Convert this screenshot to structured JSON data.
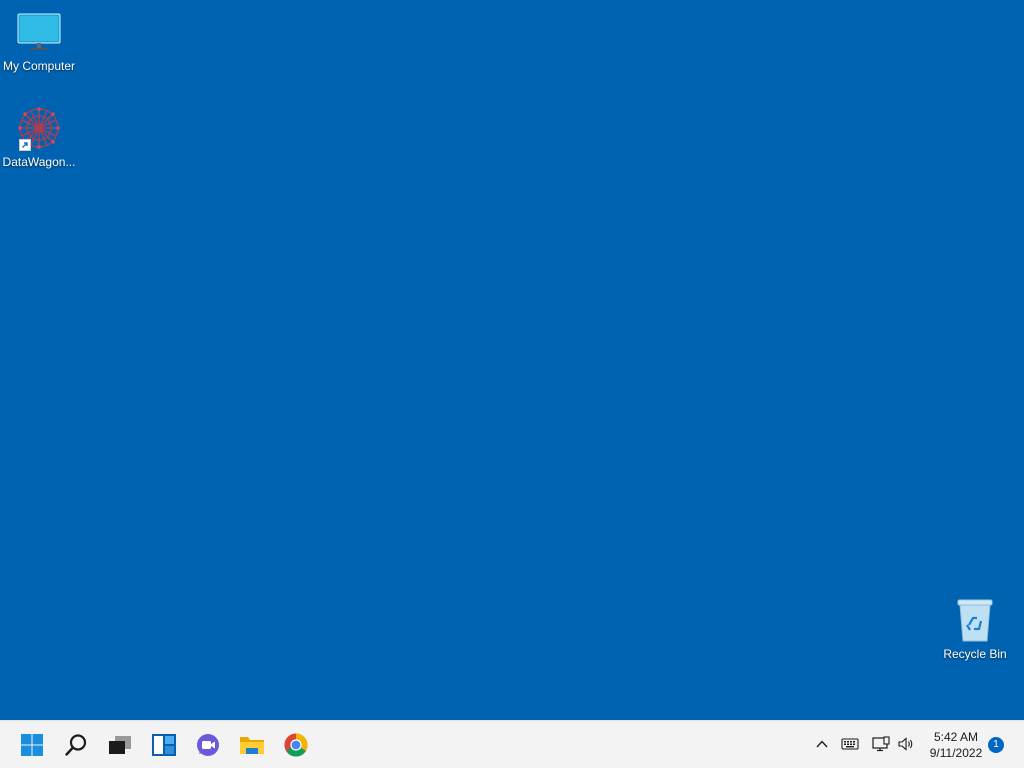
{
  "desktop": {
    "background_color": "#0063b1",
    "icons": [
      {
        "label": "My Computer",
        "icon": "monitor-icon"
      },
      {
        "label": "DataWagon...",
        "icon": "datawagon-app-icon"
      },
      {
        "label": "Recycle Bin",
        "icon": "recycle-bin-icon"
      }
    ]
  },
  "taskbar": {
    "pinned": [
      {
        "name": "Start",
        "icon": "windows-start-icon"
      },
      {
        "name": "Search",
        "icon": "search-icon"
      },
      {
        "name": "Task View",
        "icon": "task-view-icon"
      },
      {
        "name": "Widgets",
        "icon": "widgets-icon"
      },
      {
        "name": "Chat",
        "icon": "chat-icon"
      },
      {
        "name": "File Explorer",
        "icon": "folder-icon"
      },
      {
        "name": "Google Chrome",
        "icon": "chrome-icon"
      }
    ],
    "tray": {
      "icons": [
        "chevron-up-icon",
        "keyboard-icon",
        "network-icon",
        "volume-icon"
      ],
      "time": "5:42 AM",
      "date": "9/11/2022",
      "notification_count": "1"
    }
  }
}
